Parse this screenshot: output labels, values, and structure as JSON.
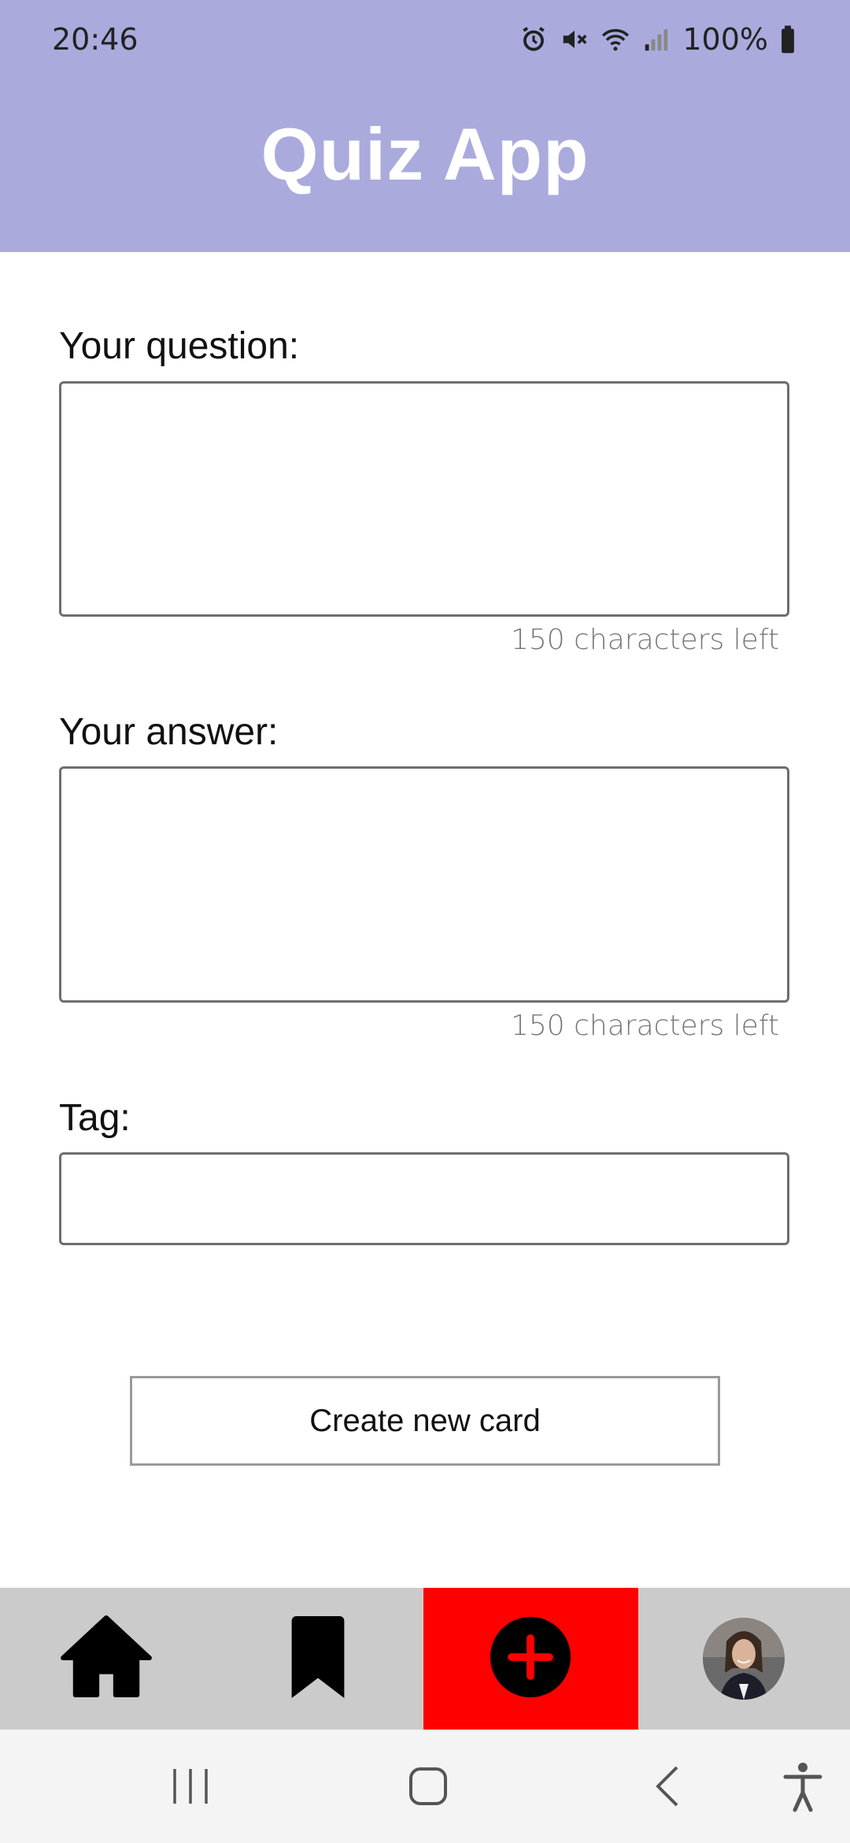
{
  "status_bar": {
    "time": "20:46",
    "battery": "100%",
    "icons": [
      "alarm-icon",
      "mute-icon",
      "wifi-icon",
      "signal-icon",
      "battery-icon"
    ]
  },
  "header": {
    "title": "Quiz App",
    "background_color": "#aaaadd"
  },
  "form": {
    "question_label": "Your question:",
    "question_value": "",
    "question_counter": "150 characters left",
    "answer_label": "Your answer:",
    "answer_value": "",
    "answer_counter": "150 characters left",
    "tag_label": "Tag:",
    "tag_value": "",
    "create_button": "Create new card"
  },
  "bottom_nav": {
    "items": [
      "home-icon",
      "bookmark-icon",
      "add-icon",
      "avatar"
    ],
    "active": "add-icon",
    "active_color": "#ff0000",
    "background_color": "#cbcbcb"
  },
  "system_nav": {
    "buttons": [
      "recent-apps-icon",
      "home-button-icon",
      "back-icon",
      "accessibility-icon"
    ]
  }
}
